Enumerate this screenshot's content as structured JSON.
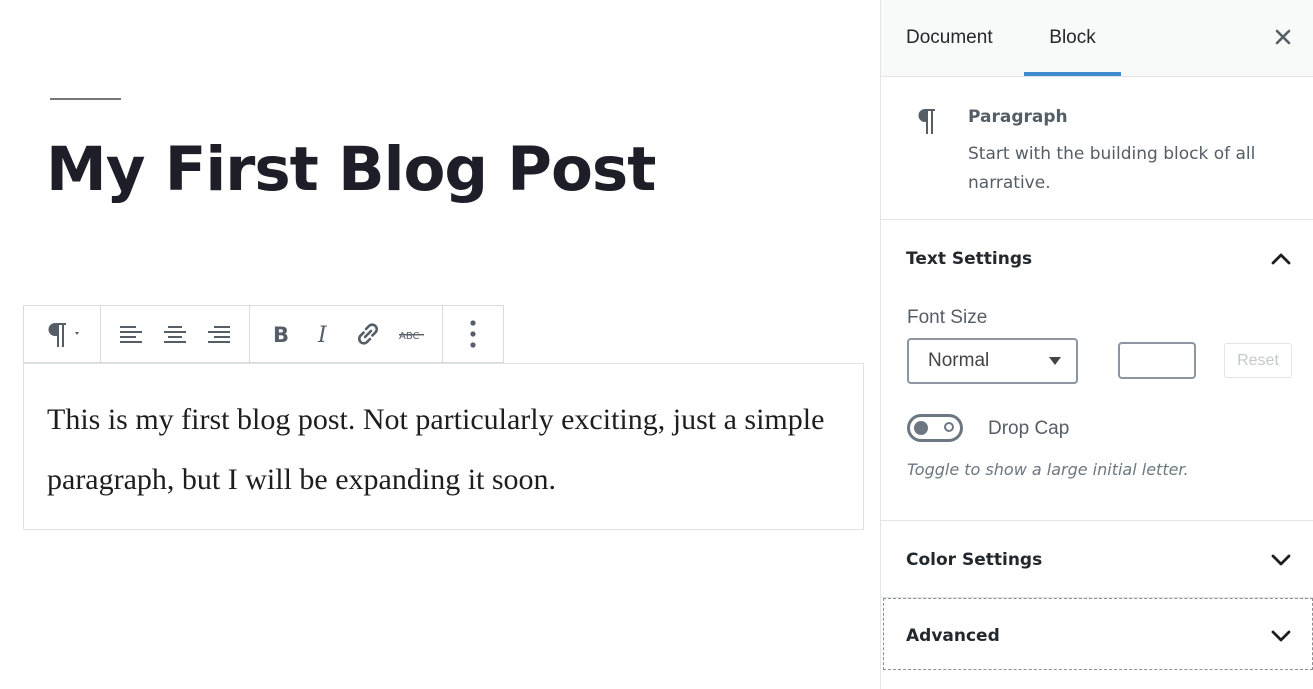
{
  "editor": {
    "post_title": "My First Blog Post",
    "paragraph_text": "This is my first blog post. Not particularly exciting, just a simple paragraph, but I will be expanding it soon.",
    "toolbar": {
      "block_type_icon": "paragraph-icon",
      "groups": [
        [
          "paragraph-icon"
        ],
        [
          "align-left-icon",
          "align-center-icon",
          "align-right-icon"
        ],
        [
          "bold-icon",
          "italic-icon",
          "link-icon",
          "strikethrough-icon"
        ],
        [
          "more-options-icon"
        ]
      ]
    }
  },
  "sidebar": {
    "tabs": [
      {
        "label": "Document",
        "active": false
      },
      {
        "label": "Block",
        "active": true
      }
    ],
    "close_icon": "close-icon",
    "block_card": {
      "icon": "paragraph-icon",
      "name": "Paragraph",
      "description": "Start with the building block of all narrative."
    },
    "text_settings": {
      "title": "Text Settings",
      "expanded": true,
      "font_size_label": "Font Size",
      "font_size_value": "Normal",
      "custom_size_value": "",
      "reset_label": "Reset",
      "drop_cap_label": "Drop Cap",
      "drop_cap_enabled": false,
      "drop_cap_help": "Toggle to show a large initial letter."
    },
    "color_settings": {
      "title": "Color Settings",
      "expanded": false
    },
    "advanced": {
      "title": "Advanced",
      "expanded": false
    }
  },
  "colors": {
    "accent": "#3e8bd0",
    "text": "#1e1e28",
    "muted": "#555d66"
  }
}
